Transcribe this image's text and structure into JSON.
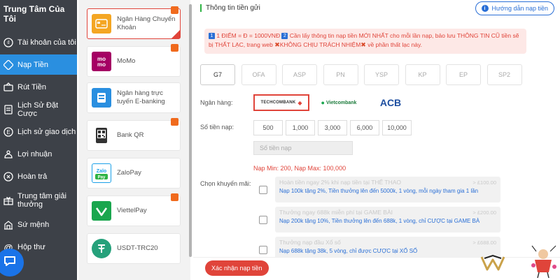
{
  "nav": {
    "title": "Trung Tâm Của Tôi",
    "items": [
      {
        "label": "Tài khoản của tôi",
        "icon": "account-icon"
      },
      {
        "label": "Nạp Tiền",
        "icon": "deposit-icon",
        "active": true
      },
      {
        "label": "Rút Tiền",
        "icon": "withdraw-icon"
      },
      {
        "label": "Lịch Sử Đặt Cược",
        "icon": "bet-history-icon"
      },
      {
        "label": "Lịch sử giao dịch",
        "icon": "transaction-history-icon"
      },
      {
        "label": "Lợi nhuận",
        "icon": "profit-icon"
      },
      {
        "label": "Hoàn trả",
        "icon": "rebate-icon"
      },
      {
        "label": "Trung tâm giải thưởng",
        "icon": "reward-center-icon"
      },
      {
        "label": "Sứ mệnh",
        "icon": "mission-icon"
      },
      {
        "label": "Hộp thư",
        "icon": "mailbox-icon"
      }
    ]
  },
  "methods": [
    {
      "label": "Ngân Hàng Chuyển Khoản",
      "logo_color": "#f4a623",
      "active": true,
      "hot": true
    },
    {
      "label": "MoMo",
      "logo_color": "#a50064",
      "hot": true
    },
    {
      "label": "Ngân hàng trực tuyến E-banking",
      "logo_color": "#2a8fe0"
    },
    {
      "label": "Bank QR",
      "logo_color": "#e8e8e8",
      "hot": true
    },
    {
      "label": "ZaloPay",
      "logo_color": "#1aa0e8"
    },
    {
      "label": "ViettelPay",
      "logo_color": "#1aa64e",
      "hot": true
    },
    {
      "label": "USDT-TRC20",
      "logo_color": "#26a17b"
    }
  ],
  "main": {
    "title": "Thông tin tiền gửi",
    "guide_label": "Hướng dẫn nạp tiền",
    "notice": {
      "n1": "1",
      "part1": "1 ĐIỂM = Đ = 1000VNĐ",
      "n2": "2",
      "part2": "Cần lấy thông tin nạp tiền MỚI NHẤT cho mỗi lần nạp, bảo lưu THÔNG TIN CŨ tiền sẽ bị THẤT LẠC, trang web",
      "part3": "KHÔNG CHỊU TRÁCH NHIỆM",
      "part4": "về phần thất lạc này."
    },
    "tabs": [
      "G7",
      "OFA",
      "ASP",
      "PN",
      "YSP",
      "KP",
      "EP",
      "SP2"
    ],
    "bank_label": "Ngân hàng:",
    "banks": [
      "TECHCOMBANK",
      "Vietcombank",
      "ACB"
    ],
    "amount_label": "Số tiền nạp:",
    "amounts": [
      "500",
      "1,000",
      "3,000",
      "6,000",
      "10,000"
    ],
    "amount_placeholder": "Số tiền nạp",
    "limits": "Nạp Min:  200,  Nạp Max:  100,000",
    "promo_label": "Chọn khuyến mãi:",
    "promos": [
      {
        "title": "Hoàn tiền ngay 2% khi nạp tiền tại THỂ THAO",
        "desc": "Nạp 100k tặng 2%, Tiền thưởng lên đến 5000k, 1 vòng, mỗi ngày tham gia 1 lần",
        "amount": "> £100.00"
      },
      {
        "title": "Thưởng ngay 688k miễn phí tại GAME BÀI",
        "desc": "Nạp 200k tặng 10%, Tiền thưởng lên đến 688k, 1 vòng, chỉ CƯỢC tại GAME BÀ",
        "amount": "> £200.00"
      },
      {
        "title": "Thưởng nạp đầu Xổ số",
        "desc": "Nạp 688k tặng 38k, 5 vòng, chỉ được CƯỢC tại XỔ SỐ",
        "amount": "> £688.00"
      }
    ],
    "confirm_label": "Xác nhận nạp tiền"
  }
}
